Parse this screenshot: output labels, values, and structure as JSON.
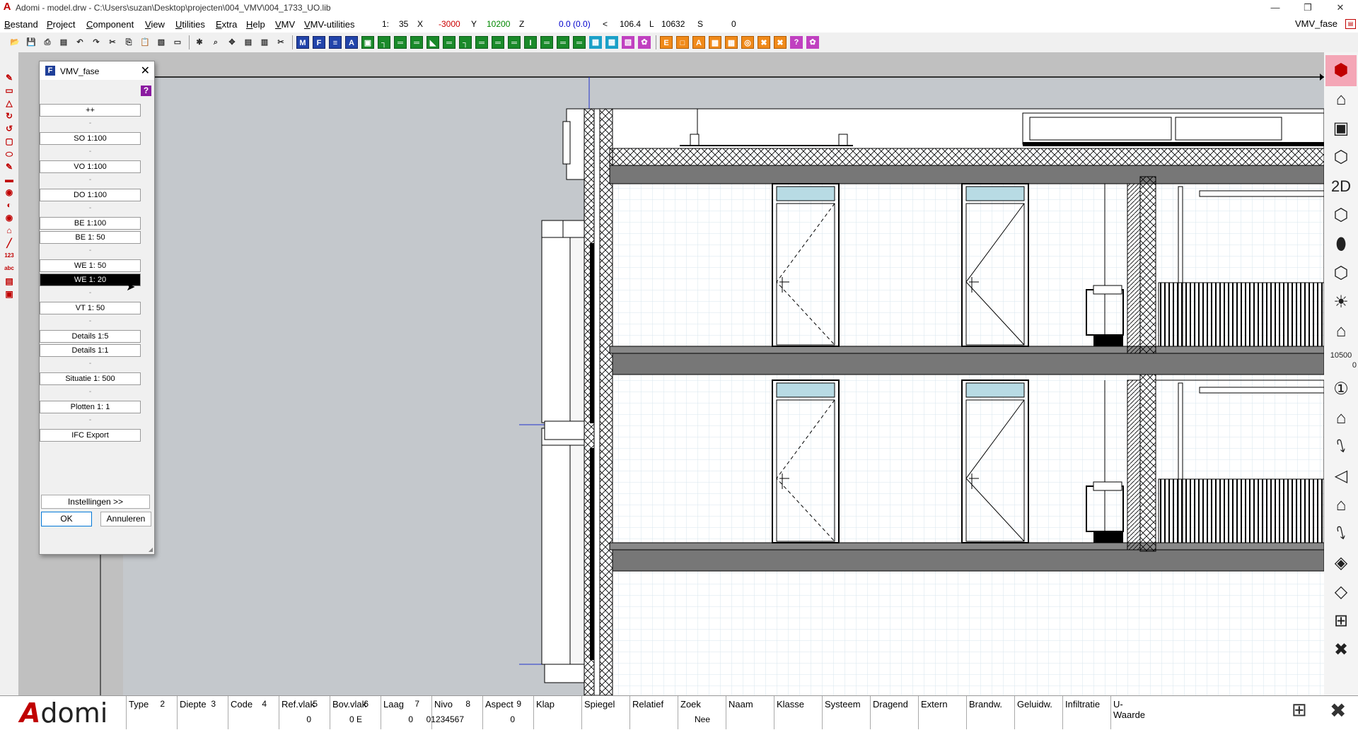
{
  "window": {
    "title": "Adomi - model.drw - C:\\Users\\suzan\\Desktop\\projecten\\004_VMV\\004_1733_UO.lib",
    "app_icon": "A",
    "minimize": "—",
    "restore": "❐",
    "close": "✕"
  },
  "menu": {
    "items": [
      "Bestand",
      "Project",
      "Component",
      "View",
      "Utilities",
      "Extra",
      "Help",
      "VMV",
      "VMV-utilities"
    ],
    "right_name": "VMV_fase"
  },
  "coords": {
    "scale_label": "1:",
    "scale_value": "35",
    "x_label": "X",
    "x_value": "-3000",
    "y_label": "Y",
    "y_value": "10200",
    "z_label": "Z",
    "z_value": "0.0 (0.0)",
    "angle_label": "<",
    "angle_value": "106.4",
    "l_label": "L",
    "l_value": "10632",
    "s_label": "S",
    "s_value": "0",
    "colors": {
      "x": "#cc0000",
      "y": "#008800",
      "z": "#0000cc"
    }
  },
  "toolbar": {
    "group1": [
      "open-icon",
      "save-icon",
      "print-icon",
      "preview-icon",
      "undo-icon",
      "redo-icon",
      "cut-icon",
      "copy-icon",
      "paste-icon",
      "paste-special-icon",
      "image-icon"
    ],
    "group2": [
      "snap-icon",
      "zoom-icon",
      "pan-icon",
      "layers-icon",
      "hatch-icon",
      "trim-icon"
    ],
    "group3_labels": [
      "M",
      "F",
      "≡",
      "A",
      "▣",
      "┐",
      "═",
      "═",
      "◣",
      "═",
      "┐",
      "═",
      "═",
      "═",
      "I",
      "═",
      "═",
      "═",
      "▦",
      "▦",
      "▧",
      "✿"
    ],
    "group4_labels": [
      "E",
      "□",
      "A",
      "▩",
      "▦",
      "◎",
      "✖",
      "✖",
      "?",
      "✿"
    ]
  },
  "left_tools": [
    "✎",
    "▭",
    "△",
    "↻",
    "↺",
    "▢",
    "⬭",
    "✎",
    "▬",
    "◉",
    "◐",
    "◉",
    "⌂",
    "╱",
    "123",
    "abc",
    "▤",
    "▣"
  ],
  "right_tools": [
    "⬢",
    "⌂",
    "▣",
    "⬡",
    "2D",
    "⬡",
    "⬮",
    "⬡",
    "☀",
    "⌂",
    "10500",
    "①",
    "⌂",
    "⭛",
    "◁",
    "⌂",
    "⭛",
    "◈",
    "◇",
    "⊞",
    "✖"
  ],
  "right_level": {
    "top": "10500",
    "bottom": "0"
  },
  "dialog": {
    "title": "VMV_fase",
    "icon_letter": "F",
    "help": "?",
    "close": "✕",
    "phases": [
      {
        "label": "++",
        "selected": false
      },
      {
        "sep": "-"
      },
      {
        "label": "SO  1:100",
        "selected": false
      },
      {
        "sep": "-"
      },
      {
        "label": "VO  1:100",
        "selected": false
      },
      {
        "sep": "-"
      },
      {
        "label": "DO  1:100",
        "selected": false
      },
      {
        "sep": "-"
      },
      {
        "label": "BE  1:100",
        "selected": false
      },
      {
        "label": "BE  1:  50",
        "selected": false
      },
      {
        "sep": "-"
      },
      {
        "label": "WE  1:  50",
        "selected": false
      },
      {
        "label": "WE  1:  20",
        "selected": true
      },
      {
        "sep": "-"
      },
      {
        "label": "VT  1: 50",
        "selected": false
      },
      {
        "sep": "-"
      },
      {
        "label": "Details 1:5",
        "selected": false
      },
      {
        "label": "Details 1:1",
        "selected": false
      },
      {
        "sep": "-"
      },
      {
        "label": "Situatie 1:  500",
        "selected": false
      },
      {
        "sep": "-"
      },
      {
        "label": "Plotten 1: 1",
        "selected": false
      },
      {
        "sep": "-"
      },
      {
        "label": "IFC Export",
        "selected": false
      }
    ],
    "settings_label": "Instellingen   >>",
    "ok_label": "OK",
    "cancel_label": "Annuleren"
  },
  "status": {
    "logo_a": "A",
    "logo_rest": "domi",
    "fields": [
      {
        "label": "Type",
        "num": "2",
        "value": ""
      },
      {
        "label": "Diepte",
        "num": "3",
        "value": ""
      },
      {
        "label": "Code",
        "num": "4",
        "value": ""
      },
      {
        "label": "Ref.vlak",
        "num": "5",
        "value": "0"
      },
      {
        "label": "Bov.vlak",
        "num": "6",
        "value": "0 E"
      },
      {
        "label": "Laag",
        "num": "7",
        "value": "0"
      },
      {
        "label": "Nivo",
        "num": "8",
        "value": "01234567"
      },
      {
        "label": "Aspect",
        "num": "9",
        "value": "0"
      },
      {
        "label": "Klap",
        "num": "",
        "value": ""
      },
      {
        "label": "Spiegel",
        "num": "",
        "value": ""
      },
      {
        "label": "Relatief",
        "num": "",
        "value": ""
      },
      {
        "label": "Zoek",
        "num": "",
        "value": "Nee"
      },
      {
        "label": "Naam",
        "num": "",
        "value": ""
      },
      {
        "label": "Klasse",
        "num": "",
        "value": ""
      },
      {
        "label": "Systeem",
        "num": "",
        "value": ""
      },
      {
        "label": "Dragend",
        "num": "",
        "value": ""
      },
      {
        "label": "Extern",
        "num": "",
        "value": ""
      },
      {
        "label": "Brandw.",
        "num": "",
        "value": ""
      },
      {
        "label": "Geluidw.",
        "num": "",
        "value": ""
      },
      {
        "label": "Infiltratie",
        "num": "",
        "value": ""
      },
      {
        "label": "U-Waarde",
        "num": "",
        "value": ""
      }
    ]
  }
}
